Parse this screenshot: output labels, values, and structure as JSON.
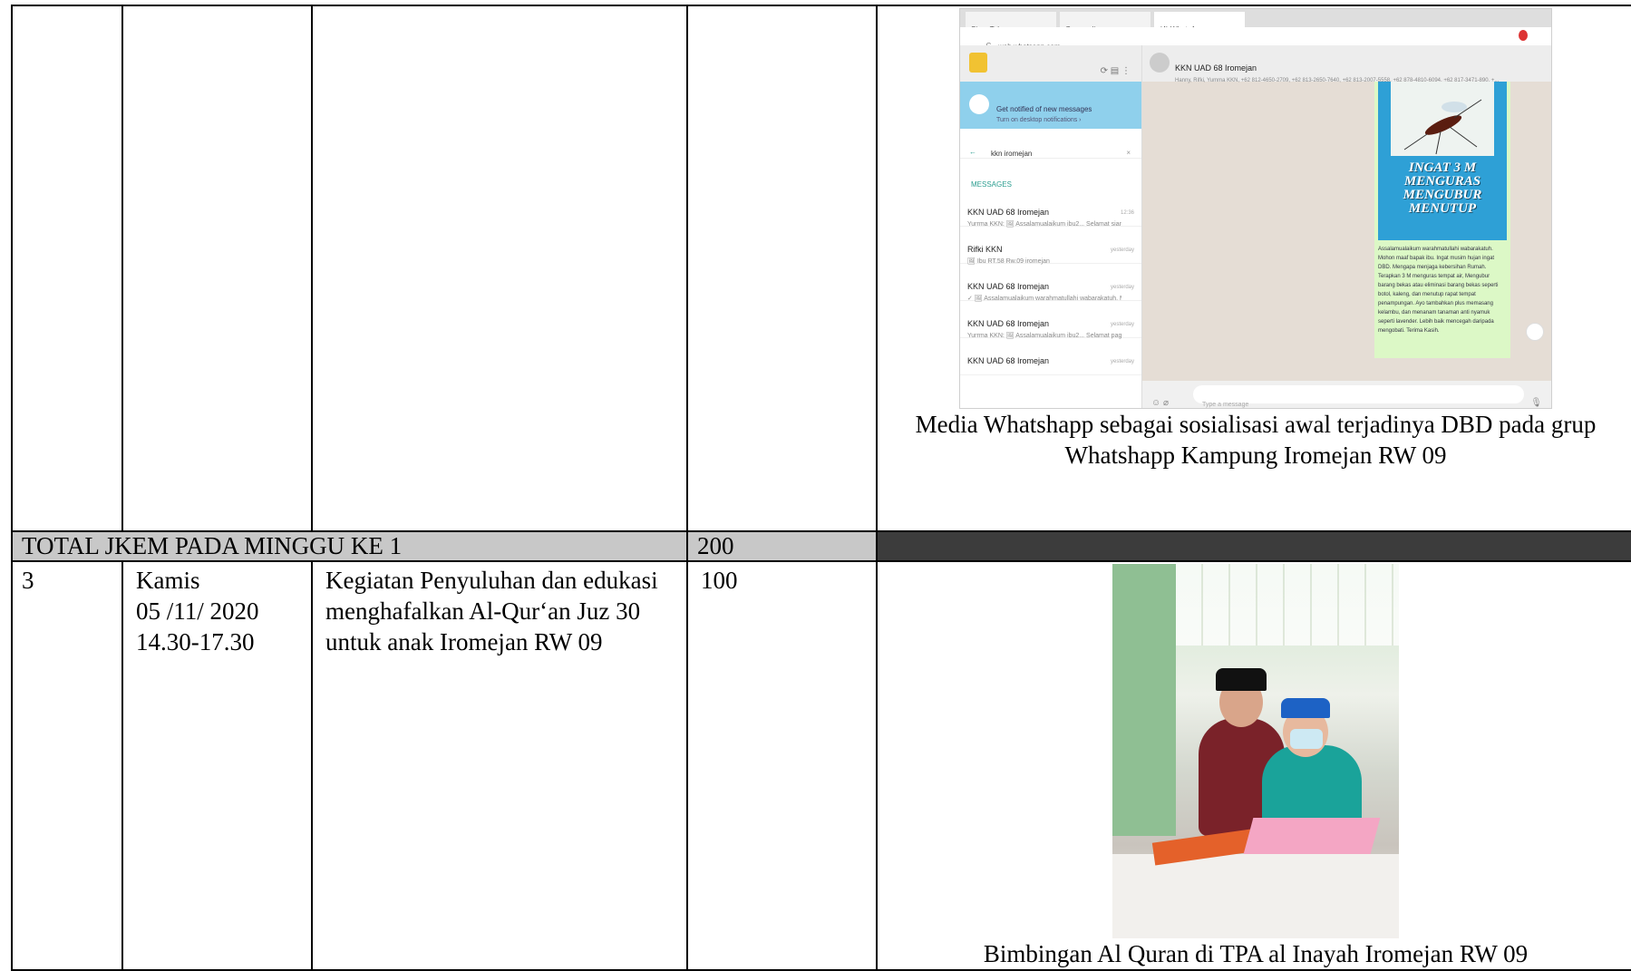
{
  "rows": [
    {
      "no": "",
      "day": "",
      "date": "",
      "time": "",
      "activity": "",
      "jkem": "",
      "caption": "Media Whatshapp sebagai sosialisasi awal terjadinya DBD pada grup Whatshapp Kampung Iromejan RW 09"
    },
    {
      "total_label": "TOTAL JKEM PADA MINGGU KE 1",
      "total_value": "200"
    },
    {
      "no": "3",
      "day": "Kamis",
      "date": "05 /11/ 2020",
      "time": "14.30-17.30",
      "activity": "Kegiatan Penyuluhan dan edukasi menghafalkan Al-Qur‘an Juz 30 untuk anak Iromejan RW 09",
      "jkem": "100",
      "caption": "Bimbingan Al Quran di TPA al Inayah Iromejan RW 09"
    }
  ],
  "whatsapp": {
    "tabs": [
      "Siaru Tab",
      "Greyscalize.com",
      "(4) WhatsApp"
    ],
    "url": "web.whatsapp.com",
    "notify_title": "Get notified of new messages",
    "notify_sub": "Turn on desktop notifications ›",
    "search_query": "kkn iromejan",
    "messages_label": "MESSAGES",
    "chats": [
      {
        "name": "KKN UAD 68 Iromejan",
        "preview": "Yurrma KKN: 🖼 Assalamualaikum ibu2... Selamat siang, P...",
        "date": "12:36"
      },
      {
        "name": "Rifki KKN",
        "preview": "🖼 Ibu RT.58 Rw.09 iromejan",
        "date": "yesterday"
      },
      {
        "name": "KKN UAD 68 Iromejan",
        "preview": "✓ 🖼 Assalamualaikum warahmatullahi wabarakatuh. Mo...",
        "date": "yesterday"
      },
      {
        "name": "KKN UAD 68 Iromejan",
        "preview": "Yurrma KKN: 🖼 Assalamualaikum ibu2... Selamat pagi, P...",
        "date": "yesterday"
      },
      {
        "name": "KKN UAD 68 Iromejan",
        "preview": "",
        "date": "yesterday"
      }
    ],
    "chat_name": "KKN UAD 68 Iromejan",
    "chat_members": "Hanny, Rifki, Yumma KKN, +62 812-4650-2709, +62 813-2650-7640, +62 813-2007-5558, +62 878-4810-6094, +62 817-3471-890, +...",
    "poster_title": "INGAT 3 M MENGURAS MENGUBUR MENUTUP",
    "poster_text": "Assalamualaikum warahmatullahi wabarakatuh. Mohon maaf bapak ibu. Ingat musim hujan ingat DBD. Mengapa menjaga kebersihan Rumah. Terapkan 3 M menguras tempat air, Mengubur barang bekas atau eliminasi barang bekas seperti botol, kaleng, dan menutup rapat tempat penampungan. Ayo tambahkan plus memasang kelambu, dan menanam tanaman anti nyamuk seperti lavender. Lebih baik mencegah daripada mengobati. Terima Kasih.",
    "composer_placeholder": "Type a message"
  }
}
